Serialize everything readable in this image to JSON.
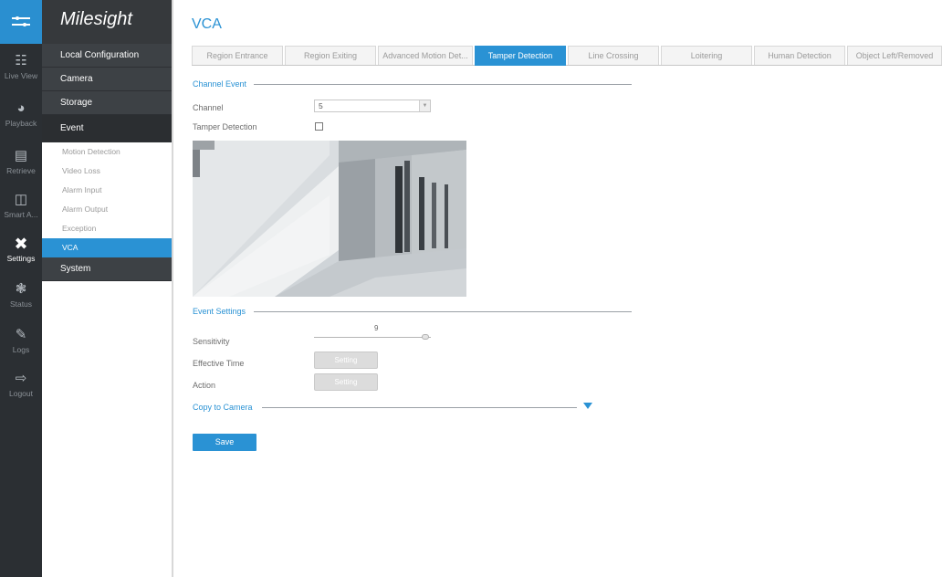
{
  "brand": {
    "logo_text": "Milesight",
    "accent_color": "#2a92d4",
    "rail_color": "#2b2f33"
  },
  "rail": {
    "top_icon": "menu-toggle-icon",
    "items": [
      {
        "label": "Live View",
        "icon": "live-view-icon"
      },
      {
        "label": "Playback",
        "icon": "playback-icon"
      },
      {
        "label": "Retrieve",
        "icon": "retrieve-icon"
      },
      {
        "label": "Smart A...",
        "icon": "smart-analysis-icon"
      },
      {
        "label": "Settings",
        "icon": "settings-icon"
      },
      {
        "label": "Status",
        "icon": "status-icon"
      },
      {
        "label": "Logs",
        "icon": "logs-icon"
      },
      {
        "label": "Logout",
        "icon": "logout-icon"
      }
    ]
  },
  "menu": {
    "local_config": "Local Configuration",
    "camera": "Camera",
    "storage": "Storage",
    "event": "Event",
    "event_items": [
      "Motion Detection",
      "Video Loss",
      "Alarm Input",
      "Alarm Output",
      "Exception",
      "VCA"
    ],
    "system": "System"
  },
  "page": {
    "title": "VCA",
    "tabs": [
      "Region Entrance",
      "Region Exiting",
      "Advanced Motion Det...",
      "Tamper Detection",
      "Line Crossing",
      "Loitering",
      "Human Detection",
      "Object Left/Removed"
    ],
    "active_tab": "Tamper Detection"
  },
  "channel_event": {
    "section_title": "Channel Event",
    "channel_label": "Channel",
    "channel_value": "5",
    "tamper_label": "Tamper Detection",
    "tamper_checked": false
  },
  "event_settings": {
    "section_title": "Event Settings",
    "sensitivity_label": "Sensitivity",
    "sensitivity_value": "9",
    "effective_time_label": "Effective Time",
    "effective_time_button": "Setting",
    "action_label": "Action",
    "action_button": "Setting"
  },
  "copy": {
    "label": "Copy to Camera"
  },
  "save_label": "Save"
}
